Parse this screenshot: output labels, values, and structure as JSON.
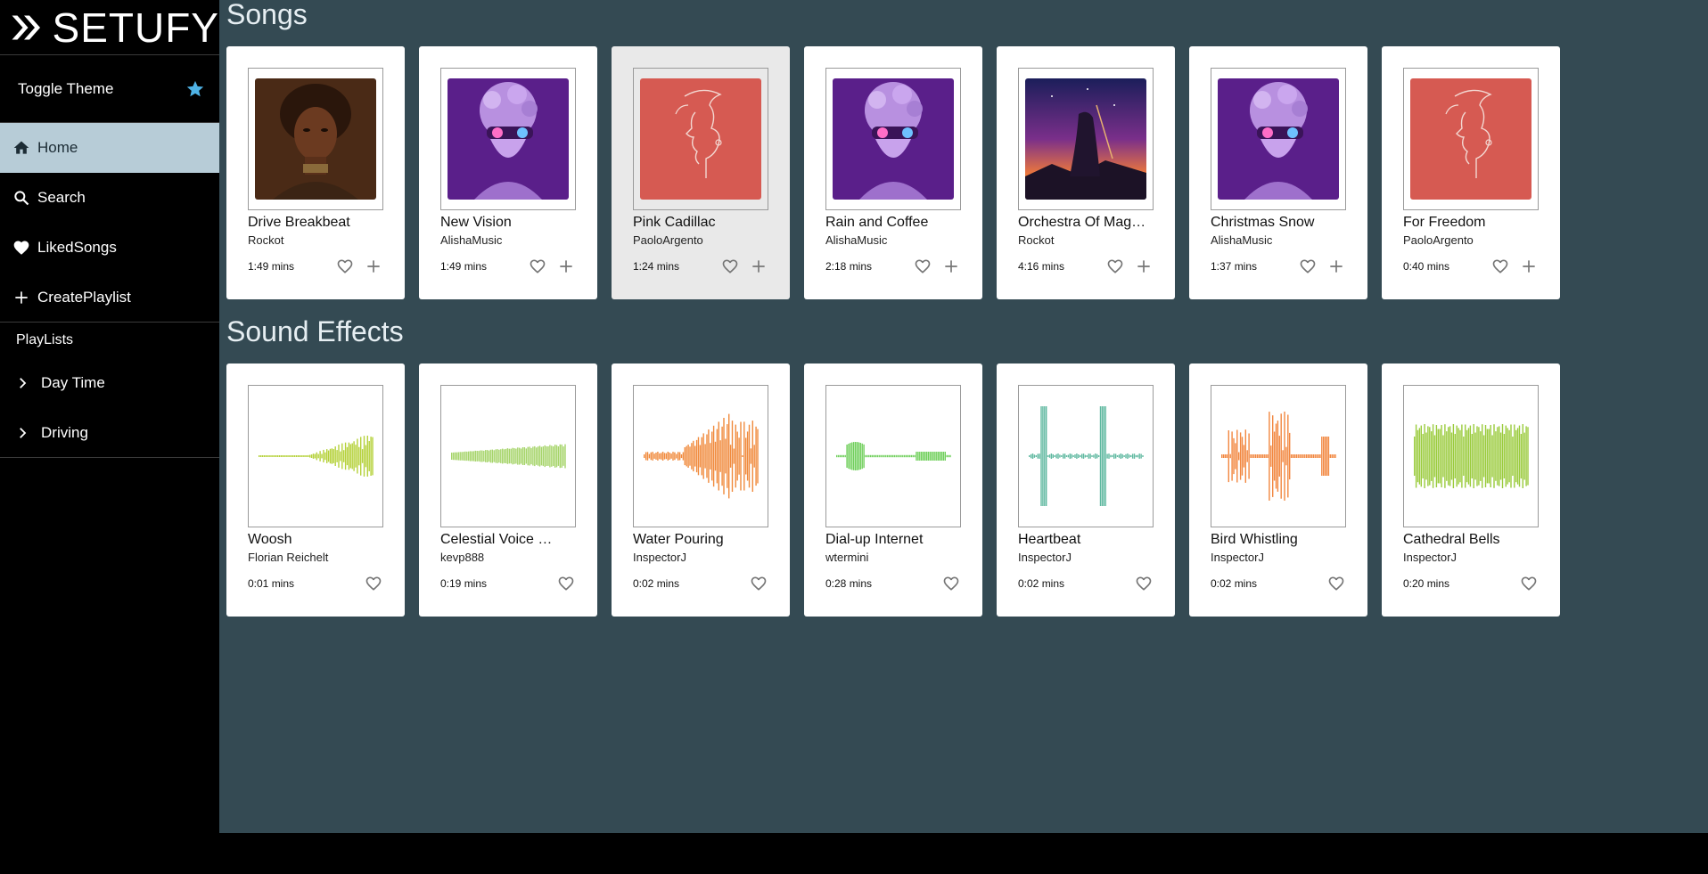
{
  "app": {
    "logo_text": "SETUFY",
    "toggle_theme": "Toggle Theme"
  },
  "nav": [
    {
      "label": "Home",
      "icon": "home-icon"
    },
    {
      "label": "Search",
      "icon": "search-icon"
    },
    {
      "label": "LikedSongs",
      "icon": "heart-icon"
    },
    {
      "label": "CreatePlaylist",
      "icon": "plus-icon"
    }
  ],
  "playlists": {
    "header": "PlayLists",
    "items": [
      {
        "label": "Day Time"
      },
      {
        "label": "Driving"
      }
    ]
  },
  "sections": {
    "songs_title": "Songs",
    "effects_title": "Sound Effects"
  },
  "songs": [
    {
      "title": "Drive Breakbeat",
      "artist": "Rockot",
      "duration": "1:49 mins",
      "art": "portrait"
    },
    {
      "title": "New Vision",
      "artist": "AlishaMusic",
      "duration": "1:49 mins",
      "art": "statue"
    },
    {
      "title": "Pink Cadillac",
      "artist": "PaoloArgento",
      "duration": "1:24 mins",
      "art": "lineface"
    },
    {
      "title": "Rain and Coffee",
      "artist": "AlishaMusic",
      "duration": "2:18 mins",
      "art": "statue"
    },
    {
      "title": "Orchestra Of Mag…",
      "artist": "Rockot",
      "duration": "4:16 mins",
      "art": "violinist"
    },
    {
      "title": "Christmas Snow",
      "artist": "AlishaMusic",
      "duration": "1:37 mins",
      "art": "statue"
    },
    {
      "title": "For Freedom",
      "artist": "PaoloArgento",
      "duration": "0:40 mins",
      "art": "lineface"
    }
  ],
  "effects": [
    {
      "title": "Woosh",
      "artist": "Florian Reichelt",
      "duration": "0:01 mins",
      "color": "#b5d13a"
    },
    {
      "title": "Celestial Voice …",
      "artist": "kevp888",
      "duration": "0:19 mins",
      "color": "#a6d46a"
    },
    {
      "title": "Water Pouring",
      "artist": "InspectorJ",
      "duration": "0:02 mins",
      "color": "#f08a3c"
    },
    {
      "title": "Dial-up Internet",
      "artist": "wtermini",
      "duration": "0:28 mins",
      "color": "#6fcf5a"
    },
    {
      "title": "Heartbeat",
      "artist": "InspectorJ",
      "duration": "0:02 mins",
      "color": "#5fb8a0"
    },
    {
      "title": "Bird Whistling",
      "artist": "InspectorJ",
      "duration": "0:02 mins",
      "color": "#f2873f"
    },
    {
      "title": "Cathedral Bells",
      "artist": "InspectorJ",
      "duration": "0:20 mins",
      "color": "#9acb3c"
    }
  ],
  "colors": {
    "accent": "#b7ccd7",
    "main_bg": "#344a53",
    "star": "#4fb3e6"
  }
}
